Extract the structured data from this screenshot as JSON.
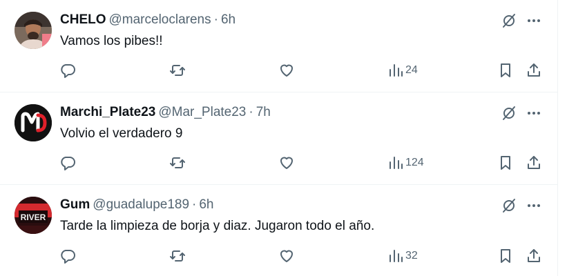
{
  "tweets": [
    {
      "name": "CHELO",
      "handle": "@marceloclarens",
      "separator": "·",
      "time": "6h",
      "text": "Vamos los pibes!!",
      "views": "24",
      "avatar_color": "#c9a58a"
    },
    {
      "name": "Marchi_Plate23",
      "handle": "@Mar_Plate23",
      "separator": "·",
      "time": "7h",
      "text": "Volvio el verdadero 9",
      "views": "124",
      "avatar_color": "#111111",
      "avatar_accent": "#e0202a"
    },
    {
      "name": "Gum",
      "handle": "@guadalupe189",
      "separator": "·",
      "time": "6h",
      "text": "Tarde la limpieza de borja y diaz. Jugaron todo el año.",
      "views": "32",
      "avatar_color": "#2a0d0f",
      "avatar_accent": "#d42a2f",
      "avatar_logo_text": "RIVER"
    }
  ],
  "icons": {
    "reply": "reply-icon",
    "retweet": "retweet-icon",
    "like": "like-icon",
    "views": "views-icon",
    "bookmark": "bookmark-icon",
    "share": "share-icon",
    "grok": "grok-icon",
    "more": "more-icon"
  },
  "colors": {
    "text_primary": "#0f1419",
    "text_secondary": "#536471",
    "divider": "#eff3f4"
  }
}
